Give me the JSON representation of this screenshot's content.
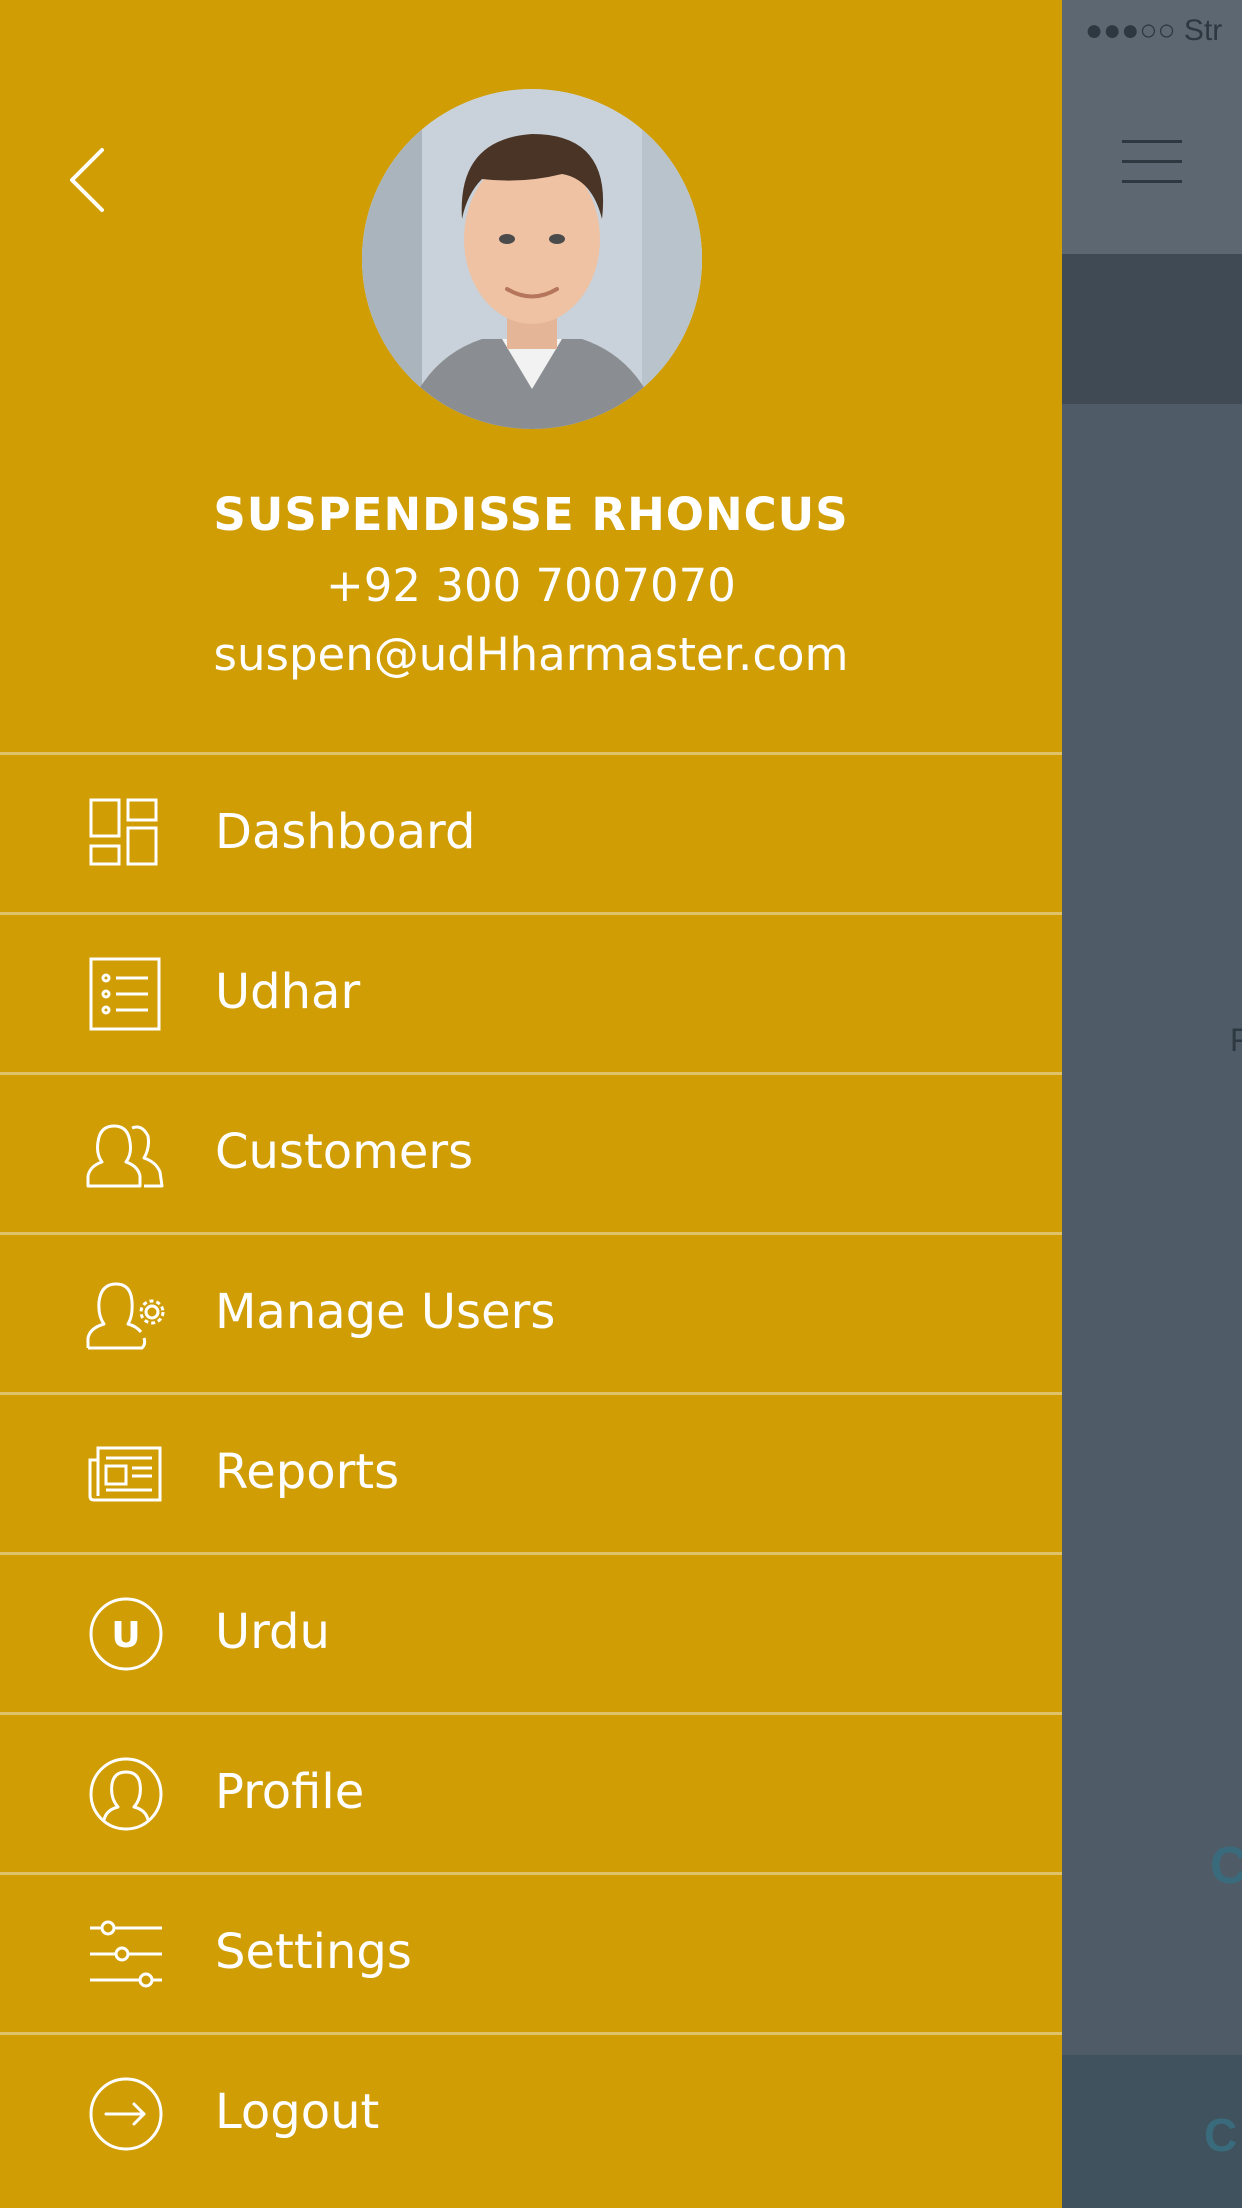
{
  "background": {
    "status_text": "●●●○○ Str",
    "partial_letter_right": "F",
    "partial_letter_c1": "C",
    "partial_letter_c2": "C"
  },
  "drawer": {
    "accent_color": "#d09d05",
    "back_icon": "chevron-left-icon",
    "profile": {
      "name": "SUSPENDISSE RHONCUS",
      "phone": "+92 300 7007070",
      "email": "suspen@udHharmaster.com"
    },
    "menu": [
      {
        "label": "Dashboard",
        "icon": "dashboard-icon"
      },
      {
        "label": "Udhar",
        "icon": "list-icon"
      },
      {
        "label": "Customers",
        "icon": "customers-icon"
      },
      {
        "label": "Manage Users",
        "icon": "manage-users-icon"
      },
      {
        "label": "Reports",
        "icon": "reports-icon"
      },
      {
        "label": "Urdu",
        "icon": "urdu-icon",
        "icon_letter": "U"
      },
      {
        "label": "Profile",
        "icon": "profile-icon"
      },
      {
        "label": "Settings",
        "icon": "settings-icon"
      },
      {
        "label": "Logout",
        "icon": "logout-icon"
      }
    ]
  }
}
